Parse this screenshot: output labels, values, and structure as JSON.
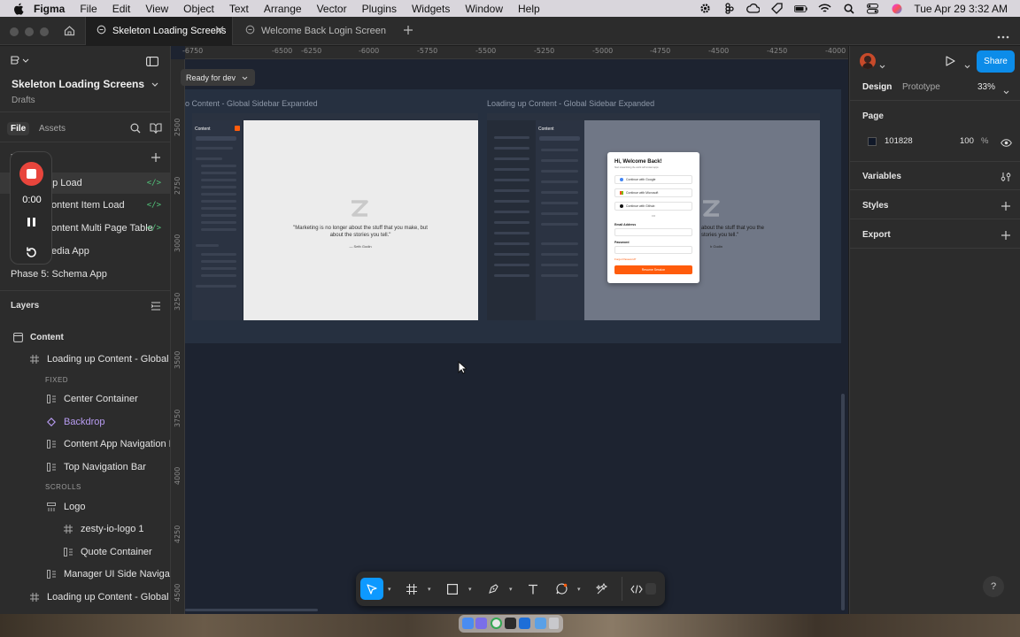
{
  "menubar": {
    "app": "Figma",
    "items": [
      "File",
      "Edit",
      "View",
      "Object",
      "Text",
      "Arrange",
      "Vector",
      "Plugins",
      "Widgets",
      "Window",
      "Help"
    ],
    "clock": "Tue Apr 29  3:32 AM"
  },
  "tabs": [
    {
      "label": "Skeleton Loading Screens",
      "active": true
    },
    {
      "label": "Welcome Back Login Screen",
      "active": false
    }
  ],
  "left": {
    "file_name": "Skeleton Loading Screens",
    "location": "Drafts",
    "tab_file": "File",
    "tab_assets": "Assets",
    "pages_label": "P",
    "pages": [
      {
        "label": "op Load",
        "dev": true
      },
      {
        "label": "ontent Item Load",
        "dev": true
      },
      {
        "label": "ontent Multi Page Table",
        "dev": true
      },
      {
        "label": "edia App",
        "dev": false
      },
      {
        "label": "Phase 5: Schema App",
        "dev": false
      }
    ],
    "dev_glyph": "</>",
    "layers_title": "Layers",
    "layers": [
      {
        "label": "Content",
        "kind": "page"
      },
      {
        "label": "Loading up Content - Global Side",
        "kind": "frame"
      },
      {
        "label": "FIXED",
        "kind": "section"
      },
      {
        "label": "Center Container",
        "kind": "auto"
      },
      {
        "label": "Backdrop",
        "kind": "component"
      },
      {
        "label": "Content App Navigation Bar",
        "kind": "auto"
      },
      {
        "label": "Top Navigation Bar",
        "kind": "auto"
      },
      {
        "label": "SCROLLS",
        "kind": "section"
      },
      {
        "label": "Logo",
        "kind": "auto"
      },
      {
        "label": "zesty-io-logo 1",
        "kind": "frame"
      },
      {
        "label": "Quote Container",
        "kind": "auto"
      },
      {
        "label": "Manager UI Side Navigation",
        "kind": "auto"
      },
      {
        "label": "Loading up Content - Global Side",
        "kind": "frame"
      }
    ]
  },
  "recorder": {
    "time": "0:00"
  },
  "canvas": {
    "ruler_x": [
      "-6750",
      "-6500",
      "-6250",
      "-6000",
      "-5750",
      "-5500",
      "-5250",
      "-5000",
      "-4750",
      "-4500",
      "-4250",
      "-4000"
    ],
    "ruler_y": [
      "2500",
      "2750",
      "3000",
      "3250",
      "3500",
      "3750",
      "4000",
      "4250",
      "4500"
    ],
    "status_pill": "Ready for dev",
    "frame1_title": "o Content - Global Sidebar Expanded",
    "frame2_title": "Loading up Content - Global Sidebar Expanded",
    "mock_sidebar_title": "Content",
    "mock_quote": "\"Marketing is no longer about the stuff that you make, but about the stories you tell.\"",
    "mock_author": "— Seth Godin",
    "mock_quote_partial": "about the stuff that you the stories you tell.\"",
    "mock_author_partial": "h Godin",
    "login": {
      "title": "Hi, Welcome Back!",
      "subtitle": "Start streamlining the world with instant apps",
      "google": "Continue with Google",
      "microsoft": "Continue with Microsoft",
      "github": "Continue with Github",
      "or": "OR",
      "email_label": "Email Address",
      "password_label": "Password",
      "forgot": "Forgot Password?",
      "submit": "Resume Session"
    }
  },
  "right": {
    "share": "Share",
    "tab_design": "Design",
    "tab_prototype": "Prototype",
    "zoom": "33%",
    "page_title": "Page",
    "page_color": "101828",
    "page_opacity": "100",
    "percent_sign": "%",
    "variables": "Variables",
    "styles": "Styles",
    "export": "Export"
  },
  "help": "?",
  "colors": {
    "accent": "#0d99ff",
    "share": "#0c8ce9",
    "canvas": "#1d2330",
    "panel": "#2c2c2c",
    "dev_green": "#52c47a",
    "component_purple": "#b89cf2",
    "recorder_red": "#e8453c",
    "orange": "#ff5c0c"
  }
}
